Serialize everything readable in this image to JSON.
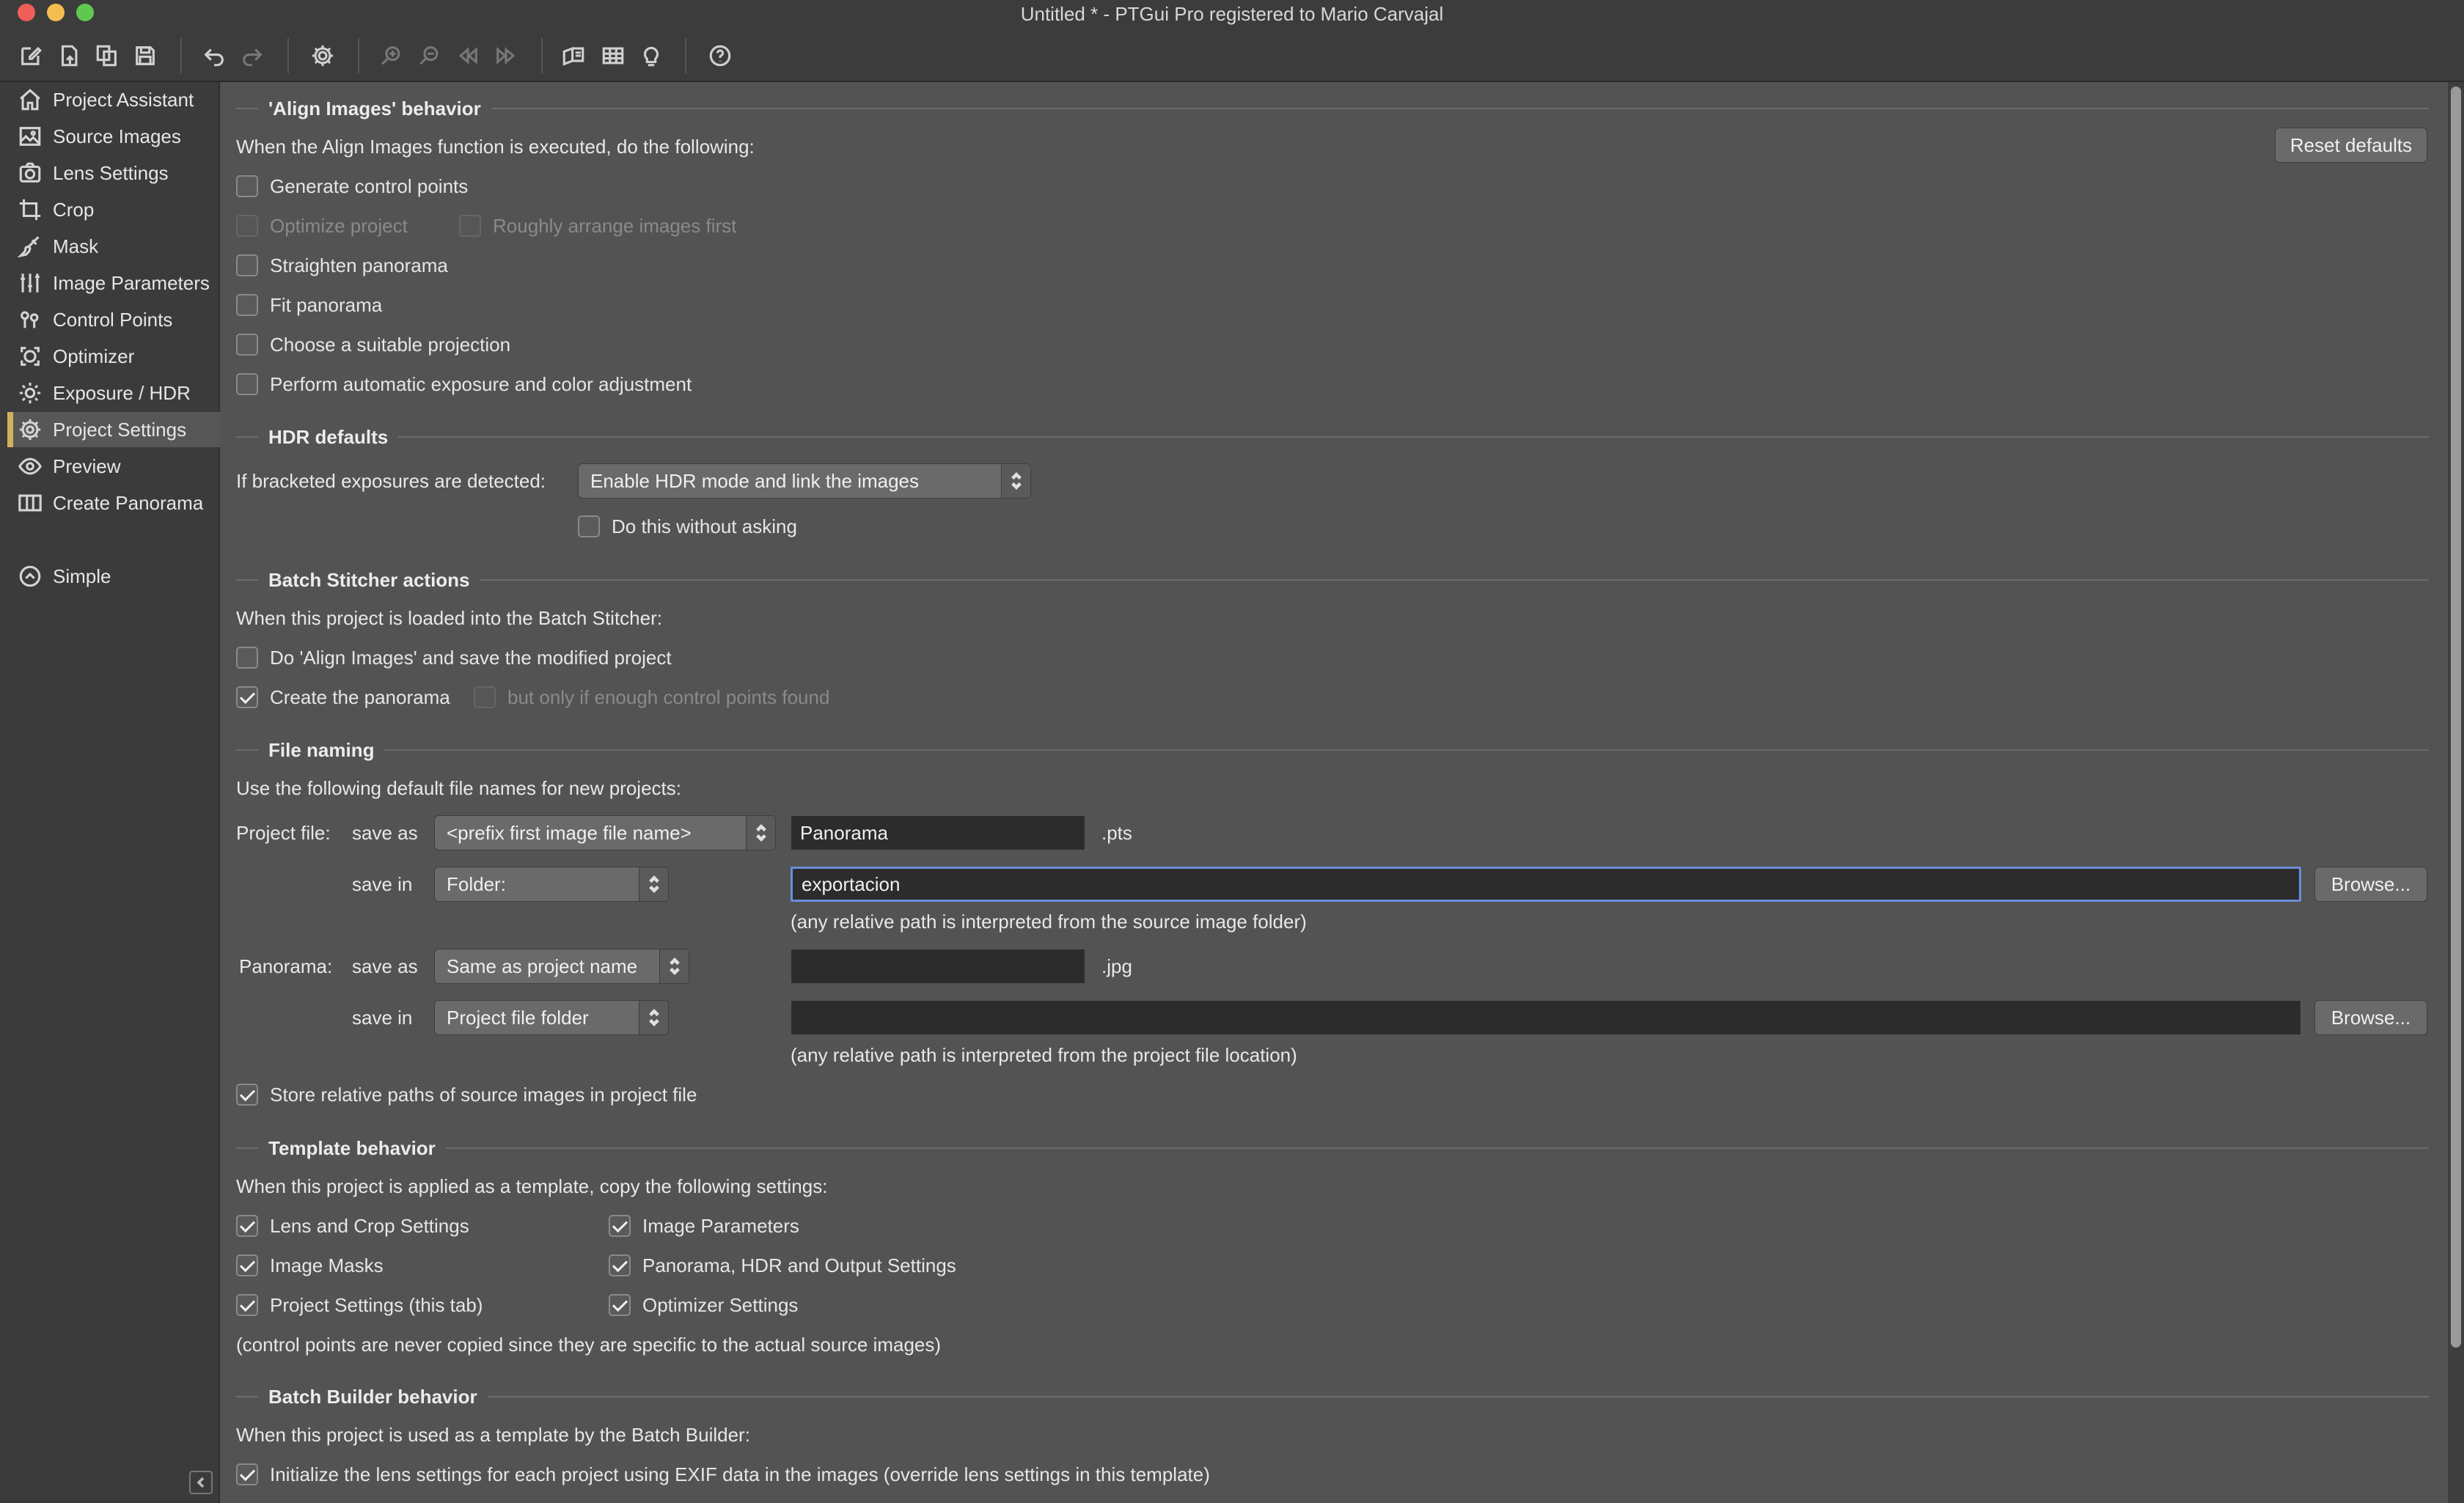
{
  "window": {
    "title": "Untitled * - PTGui Pro registered to Mario Carvajal"
  },
  "toolbar": {
    "buttons": [
      {
        "icon": "new-project-icon"
      },
      {
        "icon": "open-project-icon"
      },
      {
        "icon": "copy-project-icon"
      },
      {
        "icon": "save-icon"
      },
      {
        "icon": "undo-icon"
      },
      {
        "icon": "redo-icon"
      },
      {
        "icon": "gear-icon"
      },
      {
        "icon": "zoom-in-icon"
      },
      {
        "icon": "zoom-out-icon"
      },
      {
        "icon": "previous-icon"
      },
      {
        "icon": "next-icon"
      },
      {
        "icon": "panorama-editor-icon"
      },
      {
        "icon": "table-icon"
      },
      {
        "icon": "lightbulb-icon"
      },
      {
        "icon": "help-icon"
      }
    ]
  },
  "sidebar": {
    "items": [
      {
        "label": "Project Assistant",
        "icon": "home-icon"
      },
      {
        "label": "Source Images",
        "icon": "image-icon"
      },
      {
        "label": "Lens Settings",
        "icon": "camera-icon"
      },
      {
        "label": "Crop",
        "icon": "crop-icon"
      },
      {
        "label": "Mask",
        "icon": "brush-icon"
      },
      {
        "label": "Image Parameters",
        "icon": "sliders-icon"
      },
      {
        "label": "Control Points",
        "icon": "control-points-icon"
      },
      {
        "label": "Optimizer",
        "icon": "optimizer-icon"
      },
      {
        "label": "Exposure / HDR",
        "icon": "sun-icon"
      },
      {
        "label": "Project Settings",
        "icon": "gear-icon",
        "active": true
      },
      {
        "label": "Preview",
        "icon": "eye-icon"
      },
      {
        "label": "Create Panorama",
        "icon": "panorama-icon"
      }
    ],
    "simple_label": "Simple"
  },
  "align": {
    "heading": "'Align Images' behavior",
    "intro": "When the Align Images function is executed, do the following:",
    "reset_label": "Reset defaults",
    "generate_cp": "Generate control points",
    "optimize": "Optimize project",
    "roughly_arrange": "Roughly arrange images first",
    "straighten": "Straighten panorama",
    "fit": "Fit panorama",
    "projection": "Choose a suitable projection",
    "exposure": "Perform automatic exposure and color adjustment"
  },
  "hdr": {
    "heading": "HDR defaults",
    "label": "If bracketed exposures are detected:",
    "select_value": "Enable HDR mode and link the images",
    "without_asking": "Do this without asking"
  },
  "batch_stitcher": {
    "heading": "Batch Stitcher actions",
    "intro": "When this project is loaded into the Batch Stitcher:",
    "align_save": "Do 'Align Images' and save the modified project",
    "create_panorama": "Create the panorama",
    "only_if": "but only if enough control points found"
  },
  "file_naming": {
    "heading": "File naming",
    "intro": "Use the following default file names for new projects:",
    "project_file_label": "Project file:",
    "save_as_label": "save as",
    "save_in_label": "save in",
    "project_save_as_select": "<prefix first image file name>",
    "project_name_value": "Panorama",
    "project_ext": ".pts",
    "project_save_in_select": "Folder:",
    "project_folder_value": "exportacion",
    "browse_label": "Browse...",
    "project_note": "(any relative path is interpreted from the source image folder)",
    "panorama_label": "Panorama:",
    "panorama_save_as_select": "Same as project name",
    "panorama_name_value": "",
    "panorama_ext": ".jpg",
    "panorama_save_in_select": "Project file folder",
    "panorama_folder_value": "",
    "panorama_note": "(any relative path is interpreted from the project file location)",
    "relative_paths": "Store relative paths of source images in project file"
  },
  "template": {
    "heading": "Template behavior",
    "intro": "When this project is applied as a template, copy the following settings:",
    "lens_crop": "Lens and Crop Settings",
    "image_params": "Image Parameters",
    "image_masks": "Image Masks",
    "panorama_hdr": "Panorama, HDR and Output Settings",
    "project_settings": "Project Settings (this tab)",
    "optimizer": "Optimizer Settings",
    "note": "(control points are never copied since they are specific to the actual source images)"
  },
  "batch_builder": {
    "heading": "Batch Builder behavior",
    "intro": "When this project is used as a template by the Batch Builder:",
    "init_lens": "Initialize the lens settings for each project using EXIF data in the images (override lens settings in this template)"
  },
  "colors": {
    "background": "#535353",
    "sidebar": "#3b3b3b",
    "accent": "#d1b25a",
    "focus": "#6a8ed8"
  }
}
